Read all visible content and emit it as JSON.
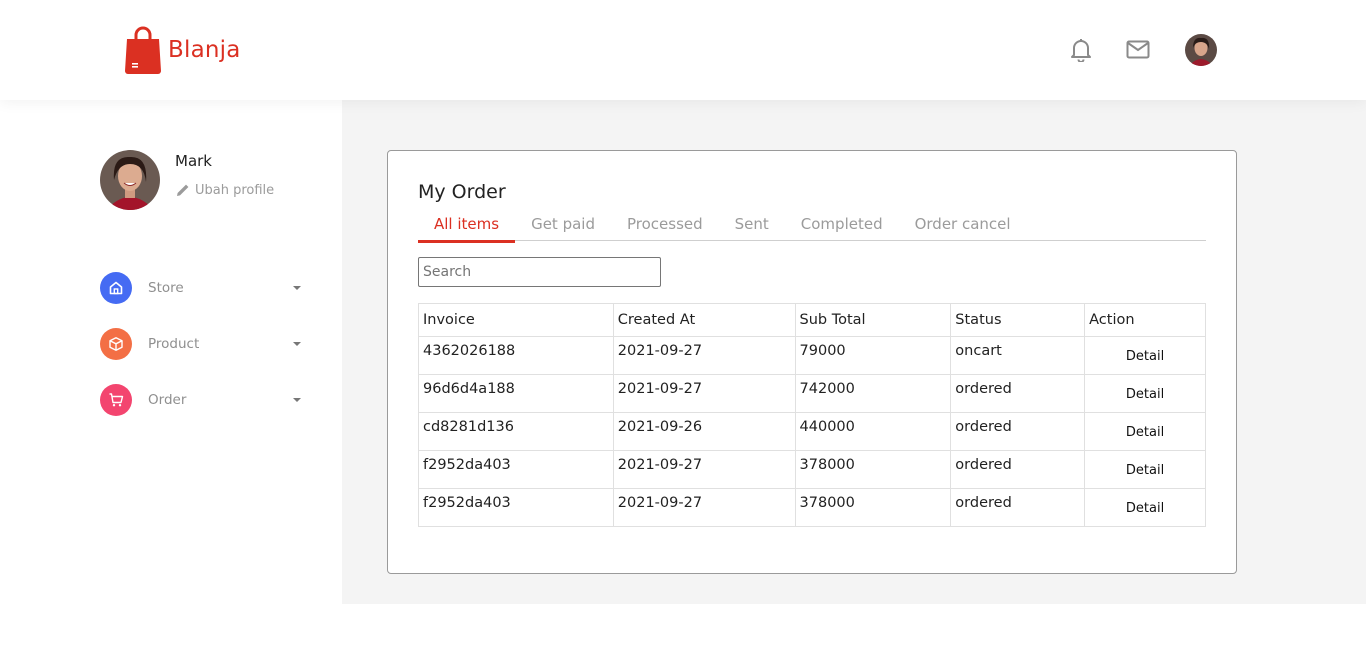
{
  "brand": {
    "name": "Blanja",
    "color": "#DB3022"
  },
  "header": {
    "icons": [
      "bell-icon",
      "mail-icon"
    ],
    "avatar_icon": "user-avatar"
  },
  "sidebar": {
    "profile": {
      "name": "Mark",
      "edit_label": "Ubah profile"
    },
    "nav": [
      {
        "label": "Store",
        "icon": "store-icon",
        "color": "#456BF3"
      },
      {
        "label": "Product",
        "icon": "box-icon",
        "color": "#F36F45"
      },
      {
        "label": "Order",
        "icon": "cart-icon",
        "color": "#F3456F"
      }
    ]
  },
  "main": {
    "title": "My Order",
    "tabs": [
      "All items",
      "Get paid",
      "Processed",
      "Sent",
      "Completed",
      "Order cancel"
    ],
    "active_tab": "All items",
    "search": {
      "placeholder": "Search",
      "value": ""
    },
    "table": {
      "columns": [
        "Invoice",
        "Created At",
        "Sub Total",
        "Status",
        "Action"
      ],
      "rows": [
        {
          "invoice": "4362026188",
          "created_at": "2021-09-27",
          "sub_total": "79000",
          "status": "oncart",
          "action": "Detail"
        },
        {
          "invoice": "96d6d4a188",
          "created_at": "2021-09-27",
          "sub_total": "742000",
          "status": "ordered",
          "action": "Detail"
        },
        {
          "invoice": "cd8281d136",
          "created_at": "2021-09-26",
          "sub_total": "440000",
          "status": "ordered",
          "action": "Detail"
        },
        {
          "invoice": "f2952da403",
          "created_at": "2021-09-27",
          "sub_total": "378000",
          "status": "ordered",
          "action": "Detail"
        },
        {
          "invoice": "f2952da403",
          "created_at": "2021-09-27",
          "sub_total": "378000",
          "status": "ordered",
          "action": "Detail"
        }
      ]
    }
  }
}
